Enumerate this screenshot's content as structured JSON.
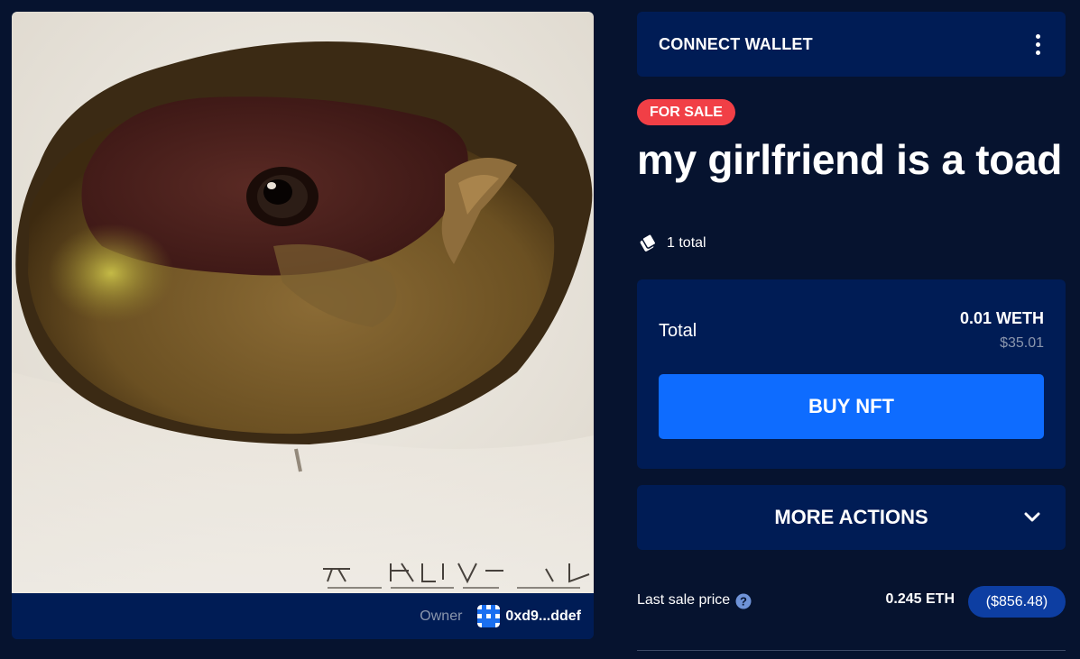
{
  "header": {
    "connect_wallet_label": "CONNECT WALLET"
  },
  "nft": {
    "status_badge": "FOR SALE",
    "title": "my girlfriend is a toad",
    "supply": "1 total",
    "owner_label": "Owner",
    "owner_address": "0xd9...ddef"
  },
  "purchase": {
    "total_label": "Total",
    "price": "0.01 WETH",
    "price_usd": "$35.01",
    "buy_label": "BUY NFT"
  },
  "actions": {
    "more_actions_label": "MORE ACTIONS"
  },
  "last_sale": {
    "label": "Last sale price",
    "eth": "0.245 ETH",
    "usd": "($856.48)"
  },
  "icons": {
    "menu": "kebab-menu-icon",
    "supply": "tickets-icon",
    "chevron": "chevron-down-icon",
    "help": "help-circle-icon",
    "avatar": "identicon-avatar"
  },
  "colors": {
    "background": "#06132f",
    "panel": "#001c55",
    "accent_blue": "#0e6cff",
    "badge_red": "#f13f46",
    "pill_blue": "#0d3ea2",
    "muted_text": "#8a96ad"
  }
}
